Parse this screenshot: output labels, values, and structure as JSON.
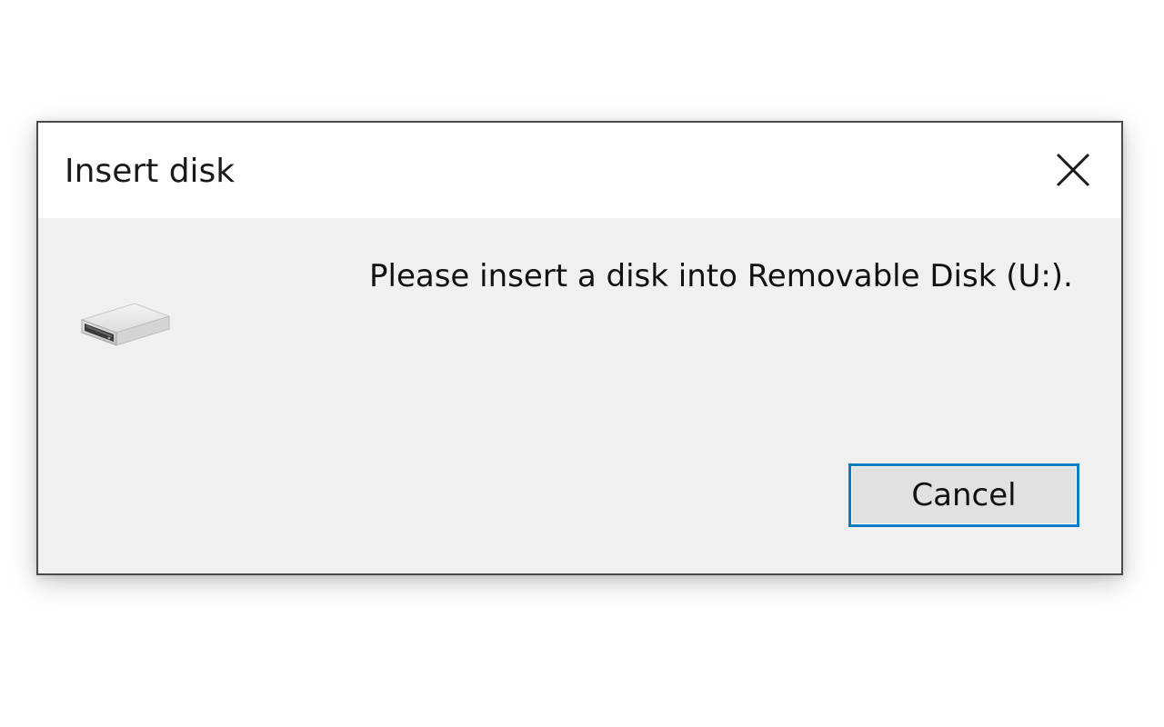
{
  "dialog": {
    "title": "Insert disk",
    "close_icon": "close-icon",
    "drive_icon": "removable-drive-icon",
    "message": "Please insert a disk into Removable Disk (U:).",
    "cancel_label": "Cancel"
  },
  "colors": {
    "title_bar": "#ffffff",
    "content_bg": "#f0f0f0",
    "button_focus_border": "#0a7cc7",
    "button_bg": "#e1e1e1"
  }
}
